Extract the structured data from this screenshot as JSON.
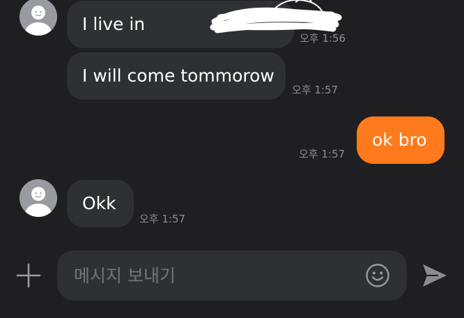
{
  "colors": {
    "background": "#1f1f22",
    "bubble_received": "#2e3034",
    "bubble_sent": "#ff7a1c",
    "timestamp": "#8d8f95",
    "icon": "#9a9ba0"
  },
  "messages": [
    {
      "sender": "other",
      "text": "I live in",
      "time": "오후 1:56",
      "redacted": true,
      "avatar": "default-avatar-icon"
    },
    {
      "sender": "other",
      "text": "I will come tommorow",
      "time": "오후 1:57"
    },
    {
      "sender": "me",
      "text": "ok bro",
      "time": "오후 1:57"
    },
    {
      "sender": "other",
      "text": "Okk",
      "time": "오후 1:57",
      "avatar": "default-avatar-icon"
    }
  ],
  "composer": {
    "placeholder": "메시지 보내기",
    "value": "",
    "icons": {
      "add": "plus-icon",
      "emoji": "smiley-icon",
      "send": "send-icon"
    }
  }
}
